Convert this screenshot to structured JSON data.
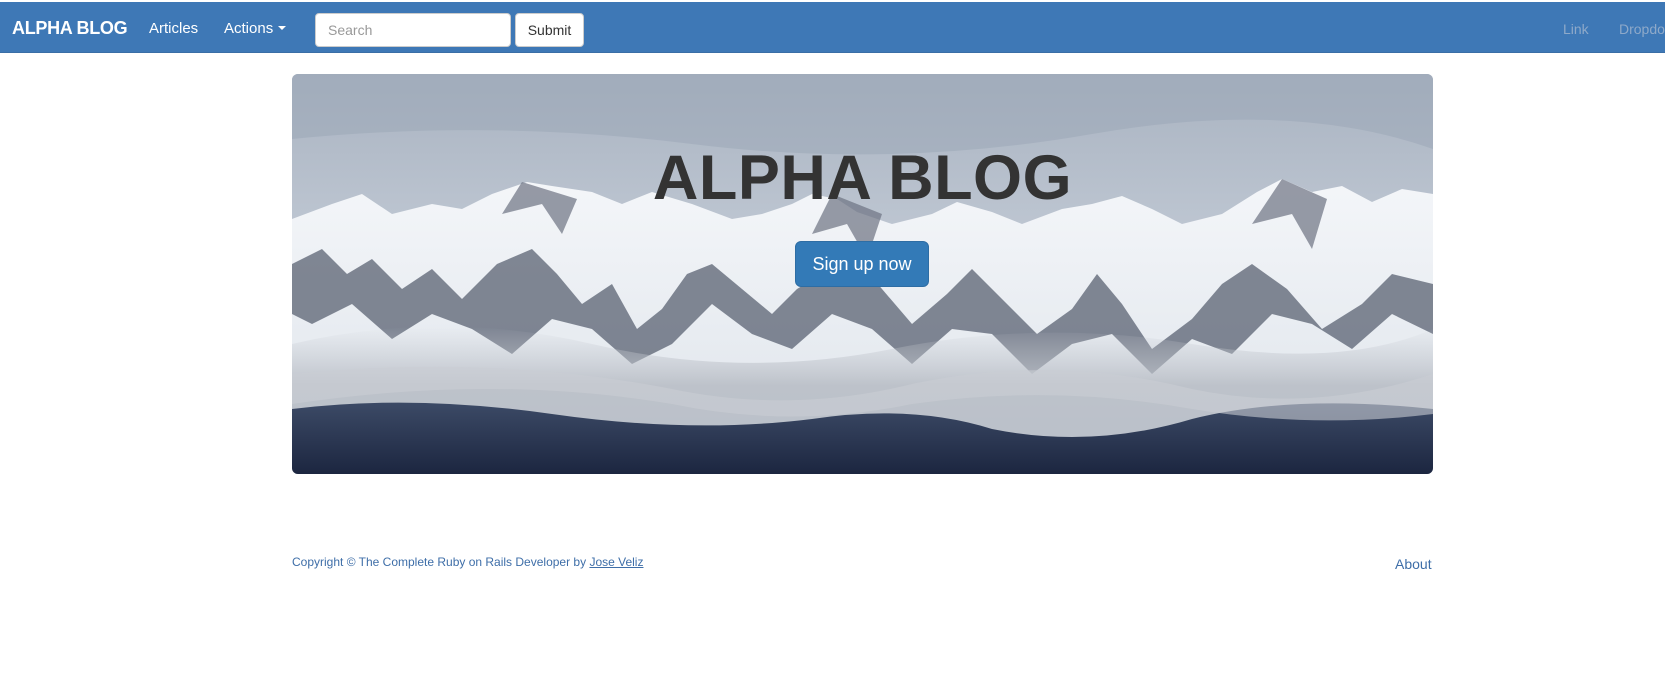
{
  "navbar": {
    "brand": "ALPHA BLOG",
    "articles_label": "Articles",
    "actions_label": "Actions",
    "search": {
      "placeholder": "Search",
      "value": ""
    },
    "submit_label": "Submit",
    "right_link_label": "Link",
    "right_dropdown_label": "Dropdo"
  },
  "jumbotron": {
    "title": "ALPHA BLOG",
    "signup_label": "Sign up now"
  },
  "footer": {
    "copyright_text": "Copyright © The Complete Ruby on Rails Developer by",
    "author_link": "Jose Veliz",
    "about_link": "About"
  },
  "colors": {
    "navbar_bg": "#3e78b6",
    "primary_button": "#337ab7",
    "title_text": "#333333",
    "footer_text": "#3e6ea8"
  }
}
